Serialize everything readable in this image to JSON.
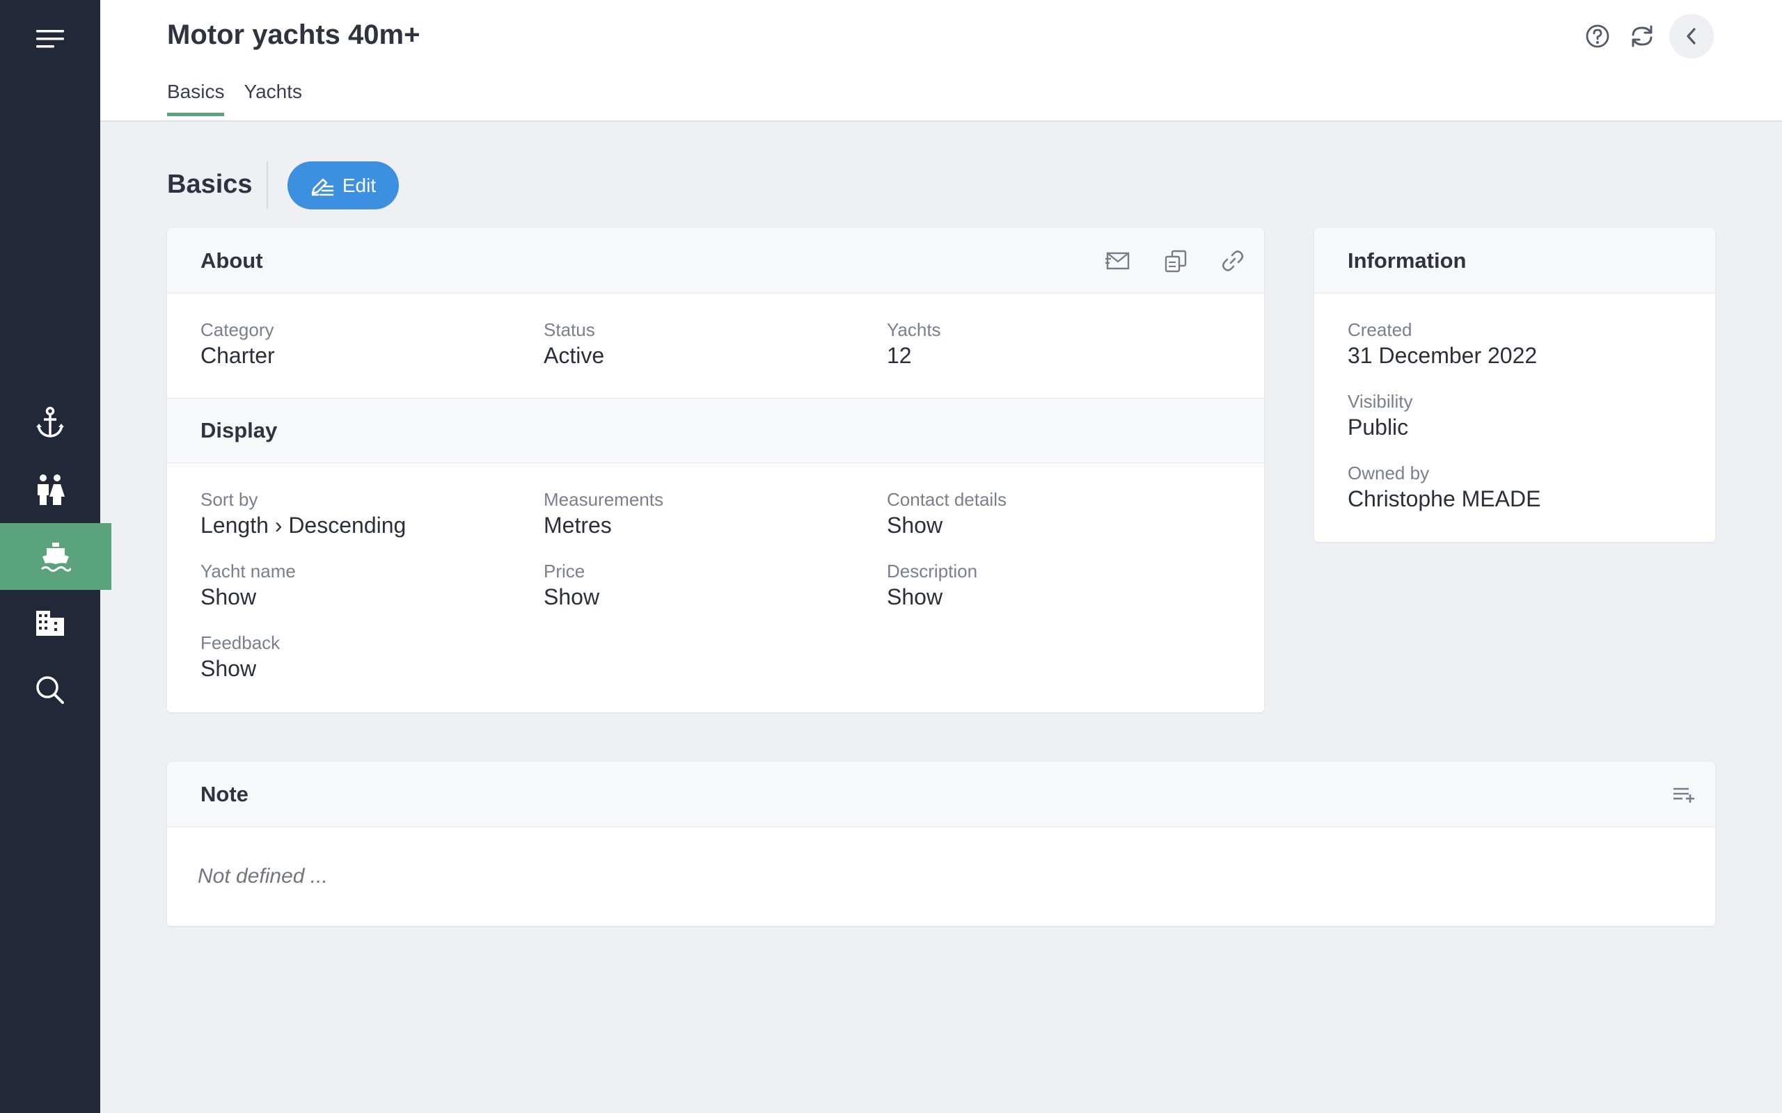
{
  "sidebar": {
    "menu_icon": "menu-icon",
    "items": [
      {
        "icon": "anchor-icon",
        "active": false
      },
      {
        "icon": "people-icon",
        "active": false
      },
      {
        "icon": "boat-icon",
        "active": true
      },
      {
        "icon": "building-icon",
        "active": false
      },
      {
        "icon": "search-icon",
        "active": false
      }
    ]
  },
  "header": {
    "title": "Motor yachts 40m+",
    "tabs": [
      {
        "label": "Basics",
        "active": true
      },
      {
        "label": "Yachts",
        "active": false
      }
    ],
    "icons": [
      "help-icon",
      "refresh-icon",
      "back-icon"
    ]
  },
  "section": {
    "title": "Basics",
    "edit_label": "Edit"
  },
  "about": {
    "title": "About",
    "icons": [
      "mail-icon",
      "copy-icon",
      "link-icon"
    ],
    "fields": [
      {
        "label": "Category",
        "value": "Charter"
      },
      {
        "label": "Status",
        "value": "Active"
      },
      {
        "label": "Yachts",
        "value": "12"
      }
    ]
  },
  "display": {
    "title": "Display",
    "fields": [
      {
        "label": "Sort by",
        "value": "Length › Descending"
      },
      {
        "label": "Measurements",
        "value": "Metres"
      },
      {
        "label": "Contact details",
        "value": "Show"
      },
      {
        "label": "Yacht name",
        "value": "Show"
      },
      {
        "label": "Price",
        "value": "Show"
      },
      {
        "label": "Description",
        "value": "Show"
      },
      {
        "label": "Feedback",
        "value": "Show"
      }
    ]
  },
  "information": {
    "title": "Information",
    "fields": [
      {
        "label": "Created",
        "value": "31 December 2022"
      },
      {
        "label": "Visibility",
        "value": "Public"
      },
      {
        "label": "Owned by",
        "value": "Christophe MEADE"
      }
    ]
  },
  "note": {
    "title": "Note",
    "add_icon": "add-note-icon",
    "empty_text": "Not defined ..."
  },
  "colors": {
    "sidebar": "#232838",
    "accent_green": "#5ba37d",
    "edit_blue": "#3d8fe0",
    "background": "#eef0f4"
  }
}
